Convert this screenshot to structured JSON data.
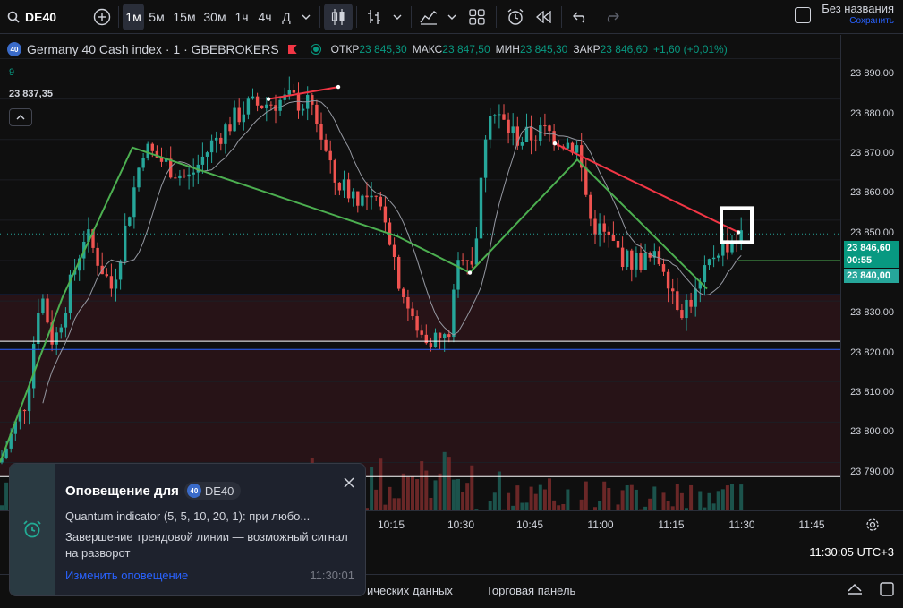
{
  "toolbar": {
    "symbol": "DE40",
    "intervals": [
      "1м",
      "5м",
      "15м",
      "30м",
      "1ч",
      "4ч",
      "Д"
    ],
    "active_interval": "1м",
    "layout_title": "Без названия",
    "save_label": "Сохранить"
  },
  "legend": {
    "instrument": "Germany 40 Cash index · 1 · GBEBROKERS",
    "badge": "40",
    "open_label": "ОТКР",
    "open_value": "23 845,30",
    "high_label": "МАКС",
    "high_value": "23 847,50",
    "low_label": "МИН",
    "low_value": "23 845,30",
    "close_label": "ЗАКР",
    "close_value": "23 846,60",
    "change": "+1,60 (+0,01%)",
    "indicator_param": "9",
    "indicator_value": "23 837,35"
  },
  "price_axis": {
    "labels": [
      "23 890,00",
      "23 880,00",
      "23 870,00",
      "23 860,00",
      "23 850,00",
      "23 830,00",
      "23 820,00",
      "23 810,00",
      "23 800,00",
      "23 790,00"
    ],
    "current_price": "23 846,60",
    "countdown": "00:55",
    "level_price": "23 840,00"
  },
  "time_axis": {
    "labels": [
      "10:15",
      "10:30",
      "10:45",
      "11:00",
      "11:15",
      "11:30",
      "11:45"
    ]
  },
  "chart_data": {
    "type": "candlestick",
    "ylim": [
      23785,
      23895
    ],
    "x": [
      "10:15",
      "10:30",
      "10:45",
      "11:00",
      "11:15",
      "11:30",
      "11:45"
    ],
    "last_close": 23846.6,
    "horizontal_levels": [
      23840.0,
      23831.5,
      23820.0,
      23818.0,
      23786.5
    ],
    "indicator_ma_value": 23837.35,
    "trendline_green": [
      [
        0,
        23790
      ],
      [
        70,
        23831
      ],
      [
        148,
        23868
      ],
      [
        444,
        23846
      ],
      [
        525,
        23837
      ],
      [
        645,
        23865
      ],
      [
        790,
        23833
      ]
    ],
    "trendline_red": [
      [
        300,
        23880
      ],
      [
        378,
        23883
      ],
      [
        620,
        23869
      ],
      [
        825,
        23847
      ]
    ]
  },
  "status": {
    "clock": "11:30:05 UTC+3"
  },
  "bottom_bar": {
    "tab_data": "ических данных",
    "tab_trading": "Торговая панель"
  },
  "notification": {
    "title": "Оповещение для",
    "chip_badge": "40",
    "chip_symbol": "DE40",
    "line1": "Quantum indicator (5, 5, 10, 20, 1): при любо...",
    "line2": "Завершение трендовой линии — возможный сигнал на разворот",
    "edit_link": "Изменить оповещение",
    "time": "11:30:01"
  },
  "colors": {
    "up": "#26a69a",
    "down": "#ef5350",
    "accent": "#2962ff",
    "green_line": "#4caf50",
    "red_line": "#f23645"
  }
}
